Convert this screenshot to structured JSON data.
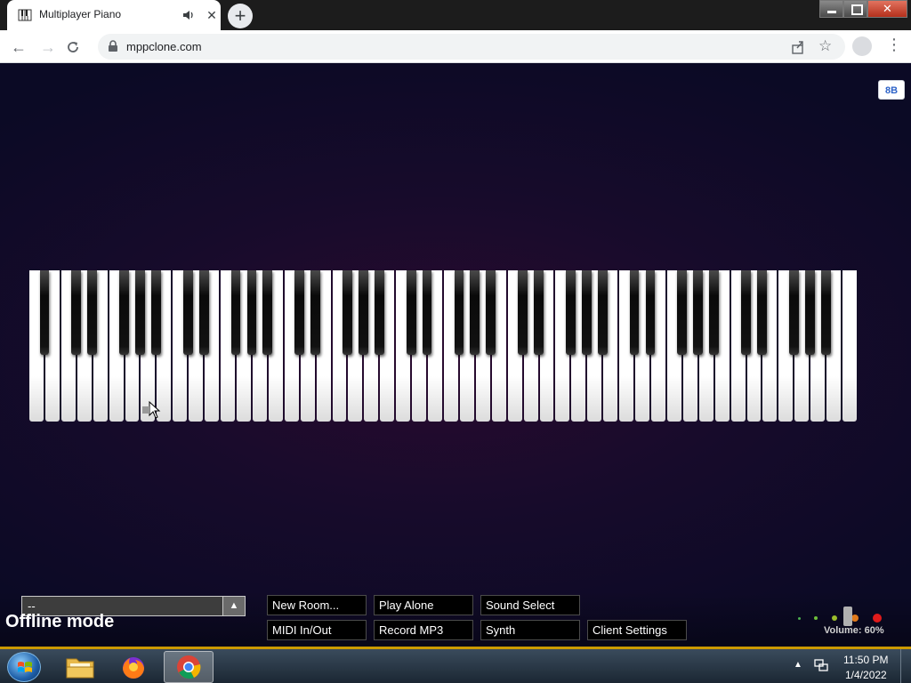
{
  "browser": {
    "tab_title": "Multiplayer Piano",
    "url": "mppclone.com",
    "close_glyph": "✕"
  },
  "page": {
    "badge_text": "8B",
    "room_value": "--",
    "status_text": "Offline mode",
    "buttons_row1": [
      "New Room...",
      "Play Alone",
      "Sound Select"
    ],
    "buttons_row2": [
      "MIDI In/Out",
      "Record MP3",
      "Synth",
      "Client Settings"
    ],
    "volume_label": "Volume: 60%",
    "volume_percent": 60
  },
  "piano": {
    "white_keys": 52,
    "black_keys": 36
  },
  "taskbar": {
    "time": "11:50 PM",
    "date": "1/4/2022",
    "apps": [
      "file-explorer",
      "firefox",
      "chrome"
    ]
  },
  "colors": {
    "accent": "#cc9a00",
    "page_bg": "#170b2b"
  }
}
